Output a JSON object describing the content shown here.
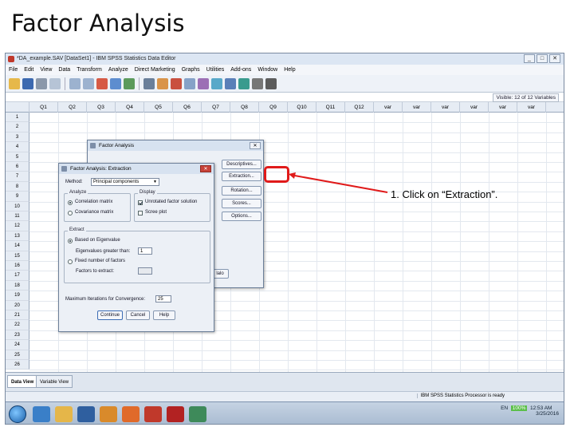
{
  "slide": {
    "title": "Factor Analysis",
    "annotation": "1. Click on “Extraction”."
  },
  "window": {
    "title": "*DA_example.SAV [DataSet1] - IBM SPSS Statistics Data Editor"
  },
  "menu": [
    "File",
    "Edit",
    "View",
    "Data",
    "Transform",
    "Analyze",
    "Direct Marketing",
    "Graphs",
    "Utilities",
    "Add-ons",
    "Window",
    "Help"
  ],
  "visible_vars": "Visible: 12 of 12 Variables",
  "columns": [
    "Q1",
    "Q2",
    "Q3",
    "Q4",
    "Q5",
    "Q6",
    "Q7",
    "Q8",
    "Q9",
    "Q10",
    "Q11",
    "Q12",
    "var",
    "var",
    "var",
    "var",
    "var",
    "var"
  ],
  "rows": [
    "1",
    "2",
    "3",
    "4",
    "5",
    "6",
    "7",
    "8",
    "9",
    "10",
    "11",
    "12",
    "13",
    "14",
    "15",
    "16",
    "17",
    "18",
    "19",
    "20",
    "21",
    "22",
    "23",
    "24",
    "25",
    "26"
  ],
  "factor_dialog": {
    "title": "Factor Analysis",
    "buttons": [
      "Descriptives...",
      "Extraction...",
      "Rotation...",
      "Scores...",
      "Options..."
    ],
    "partial_button": "lalo"
  },
  "extraction_dialog": {
    "title": "Factor Analysis: Extraction",
    "method_label": "Method:",
    "method_value": "Principal components",
    "analyze_label": "Analyze",
    "correlation": "Correlation matrix",
    "covariance": "Covariance matrix",
    "display_label": "Display",
    "unrotated": "Unrotated factor solution",
    "scree": "Scree plot",
    "extract_label": "Extract",
    "eigen_based": "Based on Eigenvalue",
    "eigen_greater": "Eigenvalues greater than:",
    "eigen_value": "1",
    "fixed": "Fixed number of factors",
    "factors_to_extract": "Factors to extract:",
    "max_iter_label": "Maximum Iterations for Convergence:",
    "max_iter_value": "25",
    "continue": "Continue",
    "cancel": "Cancel",
    "help": "Help"
  },
  "tabs": [
    "Data View",
    "Variable View"
  ],
  "status": "IBM SPSS Statistics Processor is ready",
  "tray": {
    "lang": "EN",
    "battery": "100%",
    "time": "12:53 AM",
    "date": "3/25/2016"
  }
}
